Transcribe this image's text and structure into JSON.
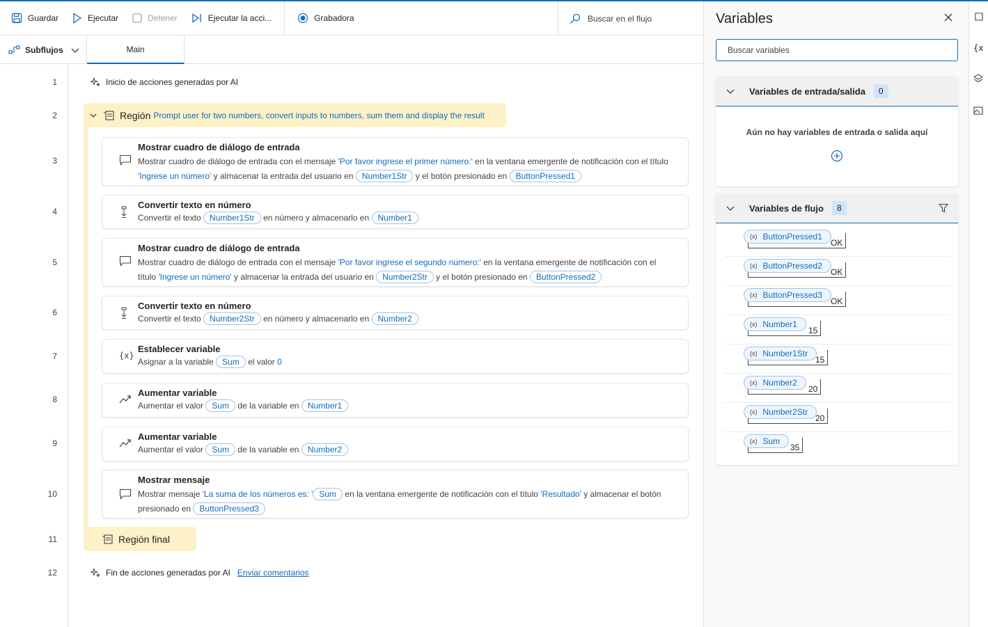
{
  "toolbar": {
    "save": "Guardar",
    "run": "Ejecutar",
    "stop": "Detener",
    "run_next": "Ejecutar la acci...",
    "recorder": "Grabadora",
    "search_placeholder": "Buscar en el flujo"
  },
  "tabs": {
    "subflows": "Subflujos",
    "main": "Main"
  },
  "editor": {
    "ai_start": "Inicio de acciones generadas por AI",
    "ai_end": "Fin de acciones generadas por AI",
    "feedback_link": "Enviar comentarios",
    "region_label": "Región",
    "region_desc": "Prompt user for two numbers, convert inputs to numbers, sum them and display the result",
    "region_end": "Región final",
    "line_numbers": [
      "1",
      "2",
      "3",
      "4",
      "5",
      "6",
      "7",
      "8",
      "9",
      "10",
      "11",
      "12"
    ],
    "actions": [
      {
        "title": "Mostrar cuadro de diálogo de entrada",
        "t1": "Mostrar cuadro de diálogo de entrada con el mensaje ",
        "q1": "'Por favor ingrese el primer número:'",
        "t2": " en la ventana emergente de notificación con el título ",
        "q2": "'Ingrese un número'",
        "t3": " y almacenar la entrada del usuario en ",
        "v1": "Number1Str",
        "t4": " y el botón presionado en ",
        "v2": "ButtonPressed1"
      },
      {
        "title": "Convertir texto en número",
        "t1": "Convertir el texto ",
        "v1": "Number1Str",
        "t2": " en número y almacenarlo en ",
        "v2": "Number1"
      },
      {
        "title": "Mostrar cuadro de diálogo de entrada",
        "t1": "Mostrar cuadro de diálogo de entrada con el mensaje ",
        "q1": "'Por favor ingrese el segundo número:'",
        "t2": " en la ventana emergente de notificación con el título ",
        "q2": "'Ingrese un número'",
        "t3": " y almacenar la entrada del usuario en ",
        "v1": "Number2Str",
        "t4": " y el botón presionado en ",
        "v2": "ButtonPressed2"
      },
      {
        "title": "Convertir texto en número",
        "t1": "Convertir el texto ",
        "v1": "Number2Str",
        "t2": " en número y almacenarlo en ",
        "v2": "Number2"
      },
      {
        "title": "Establecer variable",
        "t1": "Asignar a la variable ",
        "v1": "Sum",
        "t2": " el valor ",
        "q1": "0"
      },
      {
        "title": "Aumentar variable",
        "t1": "Aumentar el valor ",
        "v1": "Sum",
        "t2": " de la variable en ",
        "v2": "Number1"
      },
      {
        "title": "Aumentar variable",
        "t1": "Aumentar el valor ",
        "v1": "Sum",
        "t2": " de la variable en ",
        "v2": "Number2"
      },
      {
        "title": "Mostrar mensaje",
        "t1": "Mostrar mensaje ",
        "q1": "'La suma de los números es: '",
        "v1": "Sum",
        "t2": " en la ventana emergente de notificación con el título ",
        "q2": "'Resultado'",
        "t3": " y almacenar el botón presionado en ",
        "v2": "ButtonPressed3"
      }
    ]
  },
  "panel": {
    "title": "Variables",
    "search_placeholder": "Buscar variables",
    "io_section": {
      "label": "Variables de entrada/salida",
      "count": "0",
      "empty": "Aún no hay variables de entrada o salida aquí"
    },
    "flow_section": {
      "label": "Variables de flujo",
      "count": "8",
      "vars": [
        {
          "name": "ButtonPressed1",
          "value": "OK"
        },
        {
          "name": "ButtonPressed2",
          "value": "OK"
        },
        {
          "name": "ButtonPressed3",
          "value": "OK"
        },
        {
          "name": "Number1",
          "value": "15"
        },
        {
          "name": "Number1Str",
          "value": "15"
        },
        {
          "name": "Number2",
          "value": "20"
        },
        {
          "name": "Number2Str",
          "value": "20"
        },
        {
          "name": "Sum",
          "value": "35"
        }
      ]
    }
  },
  "rail": {
    "vars_label": "{x"
  }
}
